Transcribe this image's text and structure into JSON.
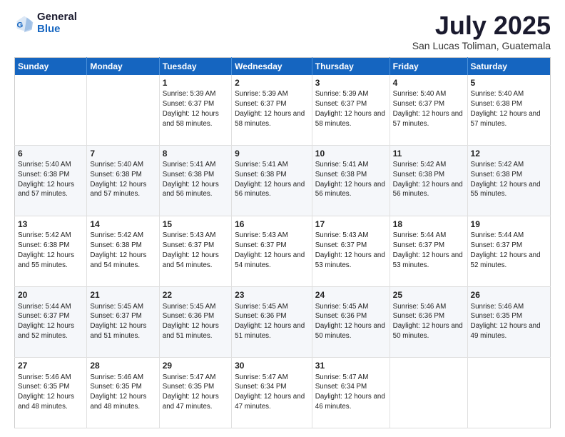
{
  "header": {
    "logo_general": "General",
    "logo_blue": "Blue",
    "main_title": "July 2025",
    "subtitle": "San Lucas Toliman, Guatemala"
  },
  "weekdays": [
    "Sunday",
    "Monday",
    "Tuesday",
    "Wednesday",
    "Thursday",
    "Friday",
    "Saturday"
  ],
  "weeks": [
    [
      {
        "day": "",
        "info": ""
      },
      {
        "day": "",
        "info": ""
      },
      {
        "day": "1",
        "info": "Sunrise: 5:39 AM\nSunset: 6:37 PM\nDaylight: 12 hours and 58 minutes."
      },
      {
        "day": "2",
        "info": "Sunrise: 5:39 AM\nSunset: 6:37 PM\nDaylight: 12 hours and 58 minutes."
      },
      {
        "day": "3",
        "info": "Sunrise: 5:39 AM\nSunset: 6:37 PM\nDaylight: 12 hours and 58 minutes."
      },
      {
        "day": "4",
        "info": "Sunrise: 5:40 AM\nSunset: 6:37 PM\nDaylight: 12 hours and 57 minutes."
      },
      {
        "day": "5",
        "info": "Sunrise: 5:40 AM\nSunset: 6:38 PM\nDaylight: 12 hours and 57 minutes."
      }
    ],
    [
      {
        "day": "6",
        "info": "Sunrise: 5:40 AM\nSunset: 6:38 PM\nDaylight: 12 hours and 57 minutes."
      },
      {
        "day": "7",
        "info": "Sunrise: 5:40 AM\nSunset: 6:38 PM\nDaylight: 12 hours and 57 minutes."
      },
      {
        "day": "8",
        "info": "Sunrise: 5:41 AM\nSunset: 6:38 PM\nDaylight: 12 hours and 56 minutes."
      },
      {
        "day": "9",
        "info": "Sunrise: 5:41 AM\nSunset: 6:38 PM\nDaylight: 12 hours and 56 minutes."
      },
      {
        "day": "10",
        "info": "Sunrise: 5:41 AM\nSunset: 6:38 PM\nDaylight: 12 hours and 56 minutes."
      },
      {
        "day": "11",
        "info": "Sunrise: 5:42 AM\nSunset: 6:38 PM\nDaylight: 12 hours and 56 minutes."
      },
      {
        "day": "12",
        "info": "Sunrise: 5:42 AM\nSunset: 6:38 PM\nDaylight: 12 hours and 55 minutes."
      }
    ],
    [
      {
        "day": "13",
        "info": "Sunrise: 5:42 AM\nSunset: 6:38 PM\nDaylight: 12 hours and 55 minutes."
      },
      {
        "day": "14",
        "info": "Sunrise: 5:42 AM\nSunset: 6:38 PM\nDaylight: 12 hours and 54 minutes."
      },
      {
        "day": "15",
        "info": "Sunrise: 5:43 AM\nSunset: 6:37 PM\nDaylight: 12 hours and 54 minutes."
      },
      {
        "day": "16",
        "info": "Sunrise: 5:43 AM\nSunset: 6:37 PM\nDaylight: 12 hours and 54 minutes."
      },
      {
        "day": "17",
        "info": "Sunrise: 5:43 AM\nSunset: 6:37 PM\nDaylight: 12 hours and 53 minutes."
      },
      {
        "day": "18",
        "info": "Sunrise: 5:44 AM\nSunset: 6:37 PM\nDaylight: 12 hours and 53 minutes."
      },
      {
        "day": "19",
        "info": "Sunrise: 5:44 AM\nSunset: 6:37 PM\nDaylight: 12 hours and 52 minutes."
      }
    ],
    [
      {
        "day": "20",
        "info": "Sunrise: 5:44 AM\nSunset: 6:37 PM\nDaylight: 12 hours and 52 minutes."
      },
      {
        "day": "21",
        "info": "Sunrise: 5:45 AM\nSunset: 6:37 PM\nDaylight: 12 hours and 51 minutes."
      },
      {
        "day": "22",
        "info": "Sunrise: 5:45 AM\nSunset: 6:36 PM\nDaylight: 12 hours and 51 minutes."
      },
      {
        "day": "23",
        "info": "Sunrise: 5:45 AM\nSunset: 6:36 PM\nDaylight: 12 hours and 51 minutes."
      },
      {
        "day": "24",
        "info": "Sunrise: 5:45 AM\nSunset: 6:36 PM\nDaylight: 12 hours and 50 minutes."
      },
      {
        "day": "25",
        "info": "Sunrise: 5:46 AM\nSunset: 6:36 PM\nDaylight: 12 hours and 50 minutes."
      },
      {
        "day": "26",
        "info": "Sunrise: 5:46 AM\nSunset: 6:35 PM\nDaylight: 12 hours and 49 minutes."
      }
    ],
    [
      {
        "day": "27",
        "info": "Sunrise: 5:46 AM\nSunset: 6:35 PM\nDaylight: 12 hours and 48 minutes."
      },
      {
        "day": "28",
        "info": "Sunrise: 5:46 AM\nSunset: 6:35 PM\nDaylight: 12 hours and 48 minutes."
      },
      {
        "day": "29",
        "info": "Sunrise: 5:47 AM\nSunset: 6:35 PM\nDaylight: 12 hours and 47 minutes."
      },
      {
        "day": "30",
        "info": "Sunrise: 5:47 AM\nSunset: 6:34 PM\nDaylight: 12 hours and 47 minutes."
      },
      {
        "day": "31",
        "info": "Sunrise: 5:47 AM\nSunset: 6:34 PM\nDaylight: 12 hours and 46 minutes."
      },
      {
        "day": "",
        "info": ""
      },
      {
        "day": "",
        "info": ""
      }
    ]
  ]
}
